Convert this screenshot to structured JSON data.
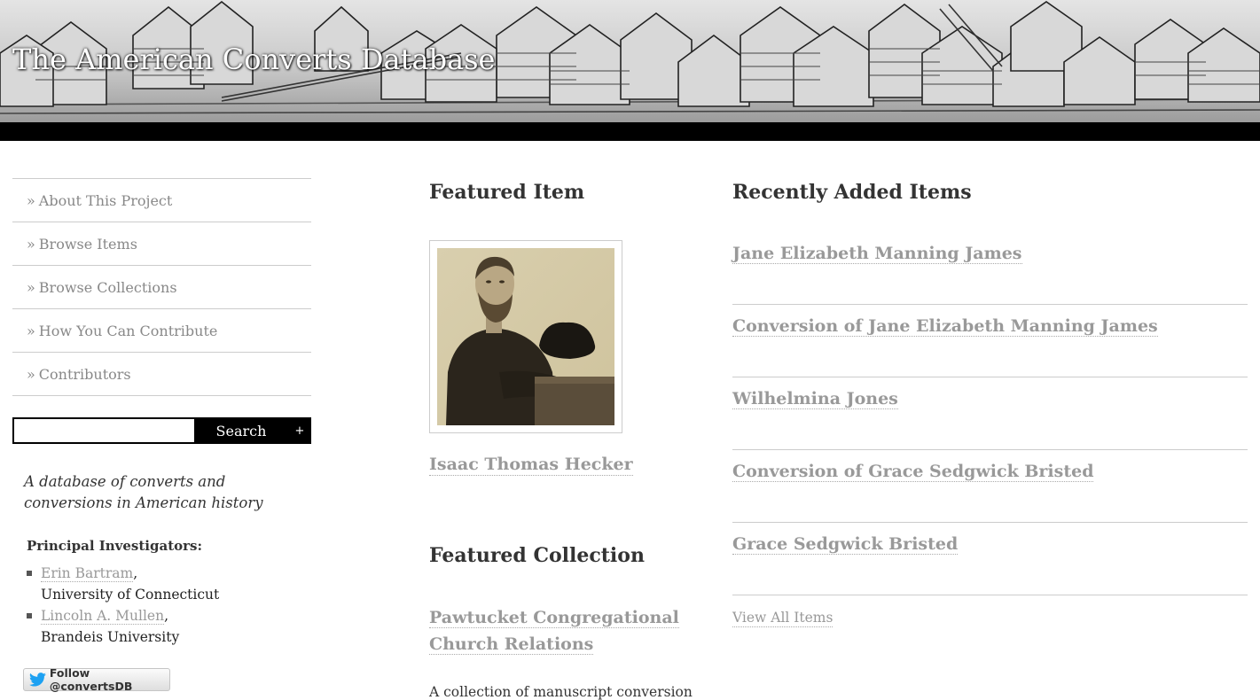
{
  "site": {
    "title": "The American Converts Database"
  },
  "nav": {
    "prefix": "»",
    "items": [
      {
        "label": "About This Project"
      },
      {
        "label": "Browse Items"
      },
      {
        "label": "Browse Collections"
      },
      {
        "label": "How You Can Contribute"
      },
      {
        "label": "Contributors"
      }
    ]
  },
  "search": {
    "value": "",
    "button_label": "Search",
    "advanced_label": "+"
  },
  "sidebar": {
    "description": "A database of converts and conversions in American history",
    "pi_heading": "Principal Investigators:",
    "investigators": [
      {
        "name": "Erin Bartram",
        "affiliation": "University of Connecticut"
      },
      {
        "name": "Lincoln A. Mullen",
        "affiliation": "Brandeis University"
      }
    ],
    "twitter_label": "Follow @convertsDB"
  },
  "featured_item": {
    "heading": "Featured Item",
    "title": "Isaac Thomas Hecker"
  },
  "featured_collection": {
    "heading": "Featured Collection",
    "title": "Pawtucket Congregational Church Relations",
    "description": "A collection of manuscript conversion"
  },
  "recent": {
    "heading": "Recently Added Items",
    "items": [
      {
        "title": "Jane Elizabeth Manning James"
      },
      {
        "title": "Conversion of Jane Elizabeth Manning James"
      },
      {
        "title": "Wilhelmina Jones"
      },
      {
        "title": "Conversion of Grace Sedgwick Bristed"
      },
      {
        "title": "Grace Sedgwick Bristed"
      }
    ],
    "view_all_label": "View All Items"
  },
  "colors": {
    "header_bar": "#000000",
    "link_gray": "#999999",
    "text": "#333333",
    "twitter_blue": "#1da1f2"
  }
}
